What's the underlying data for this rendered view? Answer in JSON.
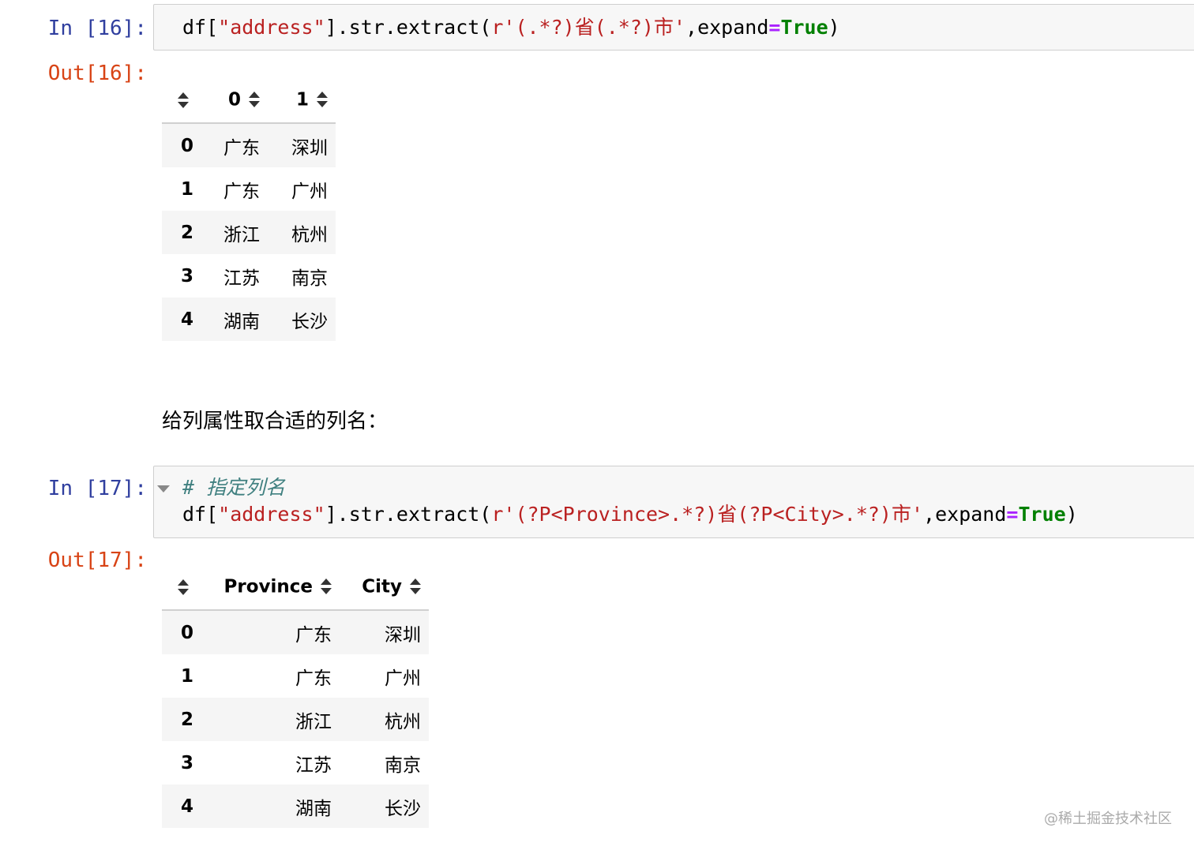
{
  "cells": [
    {
      "in_prompt": "In [16]:",
      "code": {
        "lines": [
          [
            {
              "t": "df[",
              "c": "plain"
            },
            {
              "t": "\"address\"",
              "c": "str"
            },
            {
              "t": "].str.extract(",
              "c": "plain"
            },
            {
              "t": "r'(.*?)省(.*?)市'",
              "c": "str"
            },
            {
              "t": ",expand",
              "c": "plain"
            },
            {
              "t": "=",
              "c": "op"
            },
            {
              "t": "True",
              "c": "kw"
            },
            {
              "t": ")",
              "c": "plain"
            }
          ]
        ]
      },
      "out_prompt": "Out[16]:",
      "table": {
        "columns": [
          "0",
          "1"
        ],
        "rows": [
          {
            "index": "0",
            "values": [
              "广东",
              "深圳"
            ]
          },
          {
            "index": "1",
            "values": [
              "广东",
              "广州"
            ]
          },
          {
            "index": "2",
            "values": [
              "浙江",
              "杭州"
            ]
          },
          {
            "index": "3",
            "values": [
              "江苏",
              "南京"
            ]
          },
          {
            "index": "4",
            "values": [
              "湖南",
              "长沙"
            ]
          }
        ]
      }
    },
    {
      "in_prompt": "In [17]:",
      "code": {
        "lines": [
          [
            {
              "t": "# 指定列名",
              "c": "comment"
            }
          ],
          [
            {
              "t": "df[",
              "c": "plain"
            },
            {
              "t": "\"address\"",
              "c": "str"
            },
            {
              "t": "].str.extract(",
              "c": "plain"
            },
            {
              "t": "r'(?P<Province>.*?)省(?P<City>.*?)市'",
              "c": "str"
            },
            {
              "t": ",expand",
              "c": "plain"
            },
            {
              "t": "=",
              "c": "op"
            },
            {
              "t": "True",
              "c": "kw"
            },
            {
              "t": ")",
              "c": "plain"
            }
          ]
        ]
      },
      "out_prompt": "Out[17]:",
      "table": {
        "columns": [
          "Province",
          "City"
        ],
        "rows": [
          {
            "index": "0",
            "values": [
              "广东",
              "深圳"
            ]
          },
          {
            "index": "1",
            "values": [
              "广东",
              "广州"
            ]
          },
          {
            "index": "2",
            "values": [
              "浙江",
              "杭州"
            ]
          },
          {
            "index": "3",
            "values": [
              "江苏",
              "南京"
            ]
          },
          {
            "index": "4",
            "values": [
              "湖南",
              "长沙"
            ]
          }
        ]
      }
    }
  ],
  "markdown_text": "给列属性取合适的列名：",
  "watermark": "@稀土掘金技术社区",
  "colors": {
    "in_prompt": "#303f9f",
    "out_prompt": "#d84315",
    "string": "#ba2121",
    "keyword": "#008000",
    "operator": "#aa22ff",
    "comment": "#408080"
  }
}
